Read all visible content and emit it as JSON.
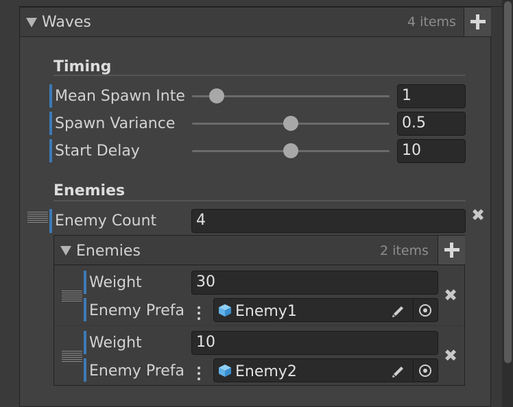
{
  "waves": {
    "title": "Waves",
    "count": "4 items",
    "timing": {
      "heading": "Timing",
      "mean_spawn": {
        "label": "Mean Spawn Inte",
        "value": "1",
        "level": 0.1
      },
      "spawn_variance": {
        "label": "Spawn Variance",
        "value": "0.5",
        "level": 0.5
      },
      "start_delay": {
        "label": "Start Delay",
        "value": "10",
        "level": 0.5
      }
    },
    "enemies_section": {
      "heading": "Enemies",
      "enemy_count": {
        "label": "Enemy Count",
        "value": "4"
      }
    }
  },
  "enemies": {
    "title": "Enemies",
    "count": "2 items",
    "items": [
      {
        "weight_label": "Weight",
        "weight": "30",
        "prefab_label": "Enemy Prefa",
        "prefab": "Enemy1"
      },
      {
        "weight_label": "Weight",
        "weight": "10",
        "prefab_label": "Enemy Prefa",
        "prefab": "Enemy2"
      }
    ]
  },
  "icons": {
    "collapse": "triangle-down-icon",
    "add": "plus-icon",
    "remove": "x-icon",
    "drag": "drag-handle-icon",
    "prefab": "cube-icon",
    "edit": "pencil-icon",
    "pick": "target-icon",
    "menu": "kebab-icon"
  },
  "colors": {
    "accent_mark": "#3d7ab5",
    "cube": "#5fb2ea"
  }
}
